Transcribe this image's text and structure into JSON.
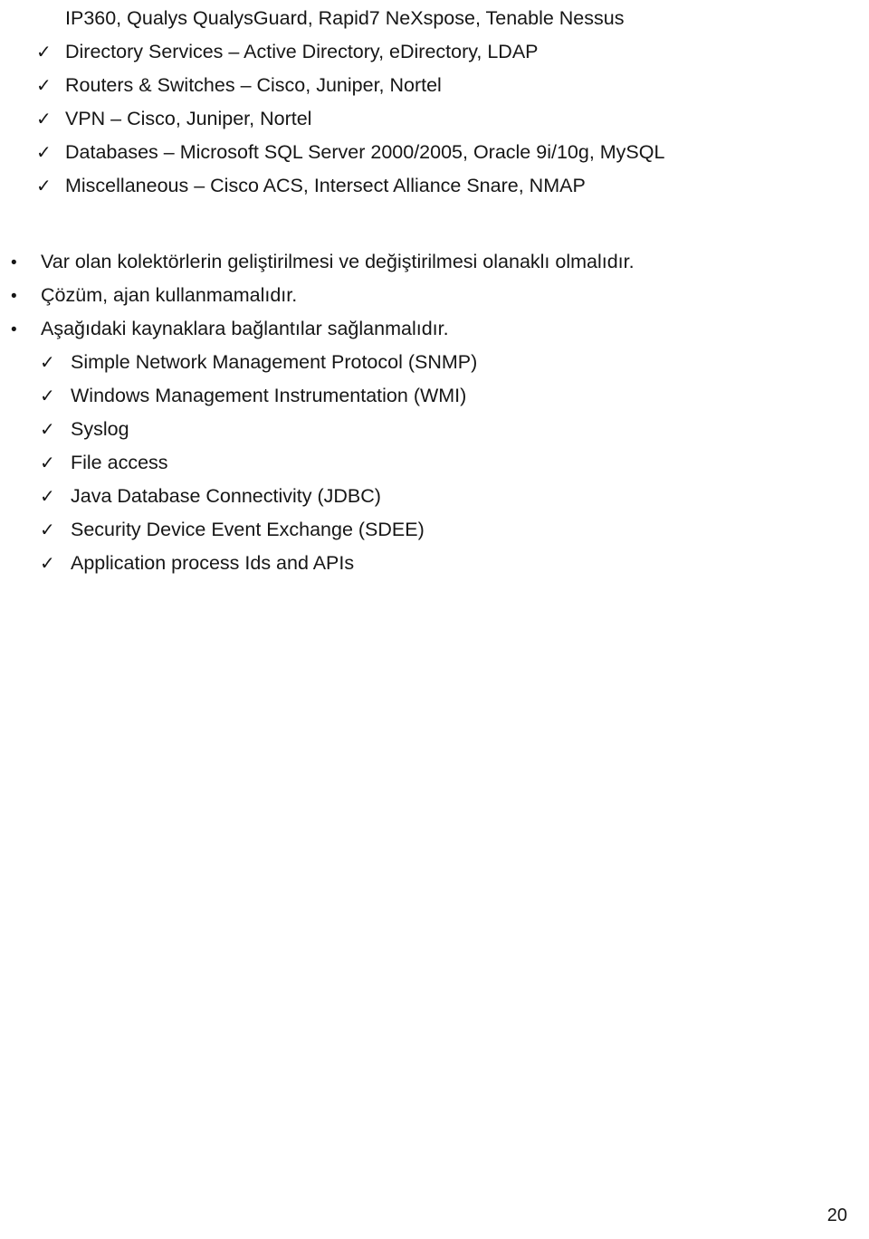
{
  "document": {
    "page_number": "20",
    "continuation_line": "IP360, Qualys QualysGuard, Rapid7 NeXspose, Tenable Nessus",
    "check_marker": "✓",
    "bullet_marker": "•",
    "top_checklist": [
      {
        "label": "Directory Services – Active Directory, eDirectory, LDAP"
      },
      {
        "label": "Routers & Switches – Cisco, Juniper, Nortel"
      },
      {
        "label": "VPN – Cisco, Juniper, Nortel"
      },
      {
        "label": "Databases – Microsoft SQL Server 2000/2005, Oracle 9i/10g, MySQL"
      },
      {
        "label": "Miscellaneous – Cisco ACS, Intersect Alliance Snare, NMAP"
      }
    ],
    "requirements_bullets": [
      {
        "label": "Var olan kolektörlerin geliştirilmesi ve değiştirilmesi olanaklı olmalıdır."
      },
      {
        "label": "Çözüm, ajan kullanmamalıdır."
      },
      {
        "label": "Aşağıdaki kaynaklara bağlantılar sağlanmalıdır."
      }
    ],
    "sources_checklist": [
      {
        "label": "Simple Network Management Protocol (SNMP)"
      },
      {
        "label": "Windows Management Instrumentation (WMI)"
      },
      {
        "label": "Syslog"
      },
      {
        "label": "File access"
      },
      {
        "label": "Java Database Connectivity (JDBC)"
      },
      {
        "label": "Security Device Event Exchange (SDEE)"
      },
      {
        "label": "Application process Ids and APIs"
      }
    ]
  },
  "colors": {
    "text": "#161616",
    "background": "#ffffff"
  }
}
